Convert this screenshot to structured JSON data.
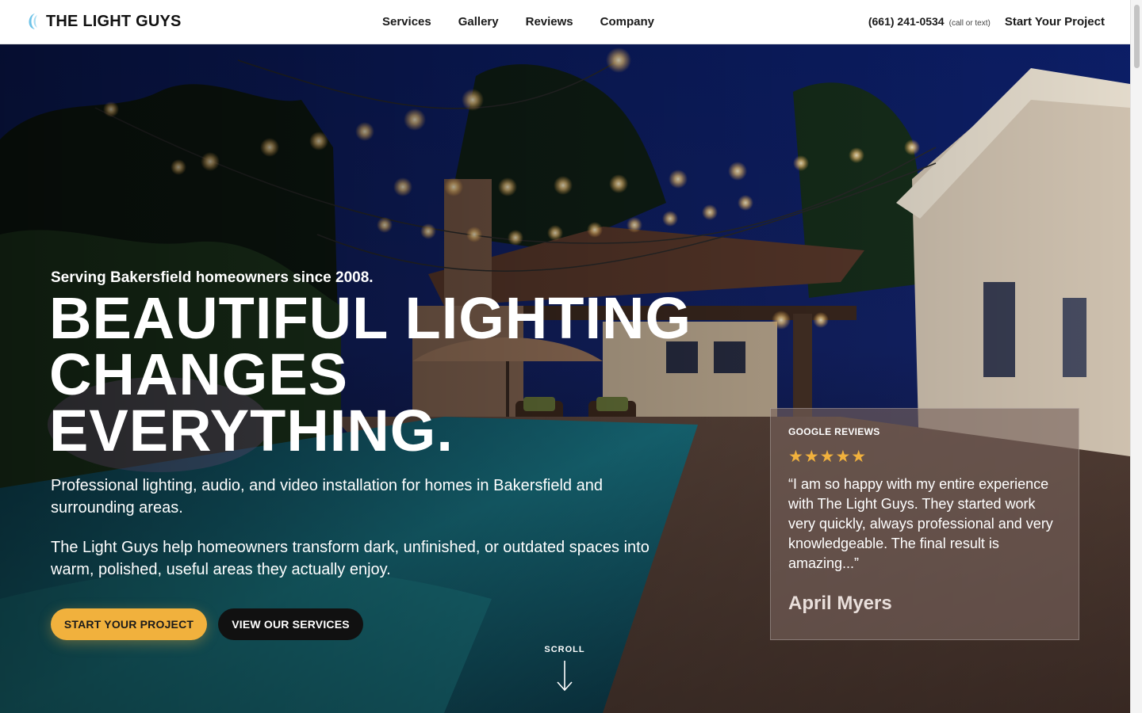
{
  "brand": {
    "name": "THE LIGHT GUYS",
    "accent": "#f1b13d"
  },
  "nav": {
    "items": [
      "Services",
      "Gallery",
      "Reviews",
      "Company"
    ]
  },
  "header": {
    "phone": "(661) 241-0534",
    "phone_note": "(call or text)",
    "cta": "Start Your Project"
  },
  "hero": {
    "tagline": "Serving Bakersfield homeowners since 2008.",
    "headline": [
      "BEAUTIFUL LIGHTING",
      "CHANGES",
      "EVERYTHING."
    ],
    "lead": "Professional lighting, audio, and video installation for homes in Bakersfield and surrounding areas.",
    "lead2": "The Light Guys help homeowners transform dark, unfinished, or outdated spaces into warm, polished, useful areas they actually enjoy.",
    "primary_button": "START YOUR PROJECT",
    "secondary_button": "VIEW OUR SERVICES",
    "scroll_label": "SCROLL"
  },
  "review": {
    "source": "GOOGLE REVIEWS",
    "stars": "★★★★★",
    "rating": 5,
    "quote": "“I am so happy with my entire experience with The Light Guys. They started work very quickly, always professional and very knowledgeable. The final result is amazing...”",
    "author": "April Myers"
  }
}
